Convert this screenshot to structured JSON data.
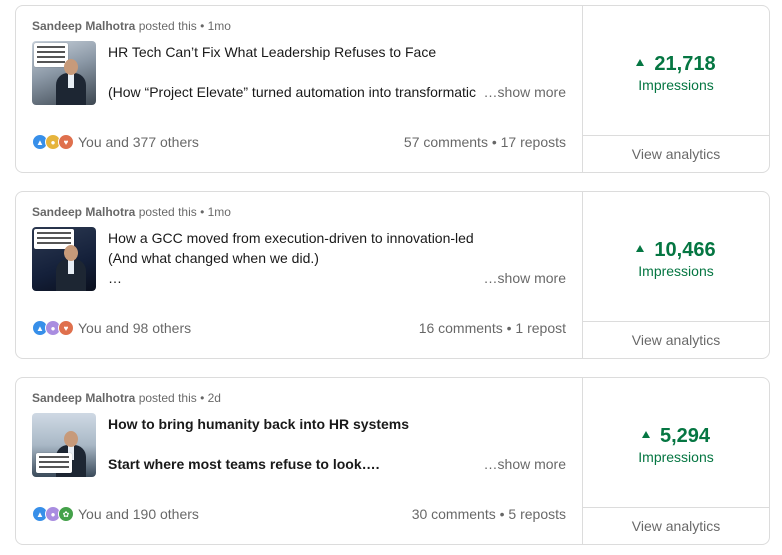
{
  "colors": {
    "accent_green": "#057642",
    "text_secondary": "rgba(0,0,0,0.6)",
    "border": "#dcdcdc"
  },
  "posts": [
    {
      "author": "Sandeep Malhotra",
      "meta": "posted this • 1mo",
      "lines": [
        "HR Tech Can’t Fix What Leadership Refuses to Face",
        "",
        "(How “Project Elevate” turned automation into transformatic"
      ],
      "show_more": "…show more",
      "reactions_icons": [
        "like-icon",
        "insight-icon",
        "love-icon"
      ],
      "reactions_text": "You and 377 others",
      "stats": "57 comments • 17 reposts",
      "impressions_value": "21,718",
      "impressions_label": "Impressions",
      "view_analytics": "View analytics"
    },
    {
      "author": "Sandeep Malhotra",
      "meta": "posted this • 1mo",
      "lines": [
        "How a GCC moved from execution-driven to innovation-led",
        "(And what changed when we did.)",
        "…"
      ],
      "show_more": "…show more",
      "reactions_icons": [
        "like-icon",
        "support-icon",
        "love-icon"
      ],
      "reactions_text": "You and 98 others",
      "stats": "16 comments • 1 repost",
      "impressions_value": "10,466",
      "impressions_label": "Impressions",
      "view_analytics": "View analytics"
    },
    {
      "author": "Sandeep Malhotra",
      "meta": "posted this • 2d",
      "lines": [
        "How to bring humanity back into HR systems",
        "",
        "Start where most teams refuse to look…."
      ],
      "show_more": "…show more",
      "reactions_icons": [
        "like-icon",
        "support-icon",
        "celebrate-icon"
      ],
      "reactions_text": "You and 190 others",
      "stats": "30 comments • 5 reposts",
      "impressions_value": "5,294",
      "impressions_label": "Impressions",
      "view_analytics": "View analytics"
    }
  ]
}
